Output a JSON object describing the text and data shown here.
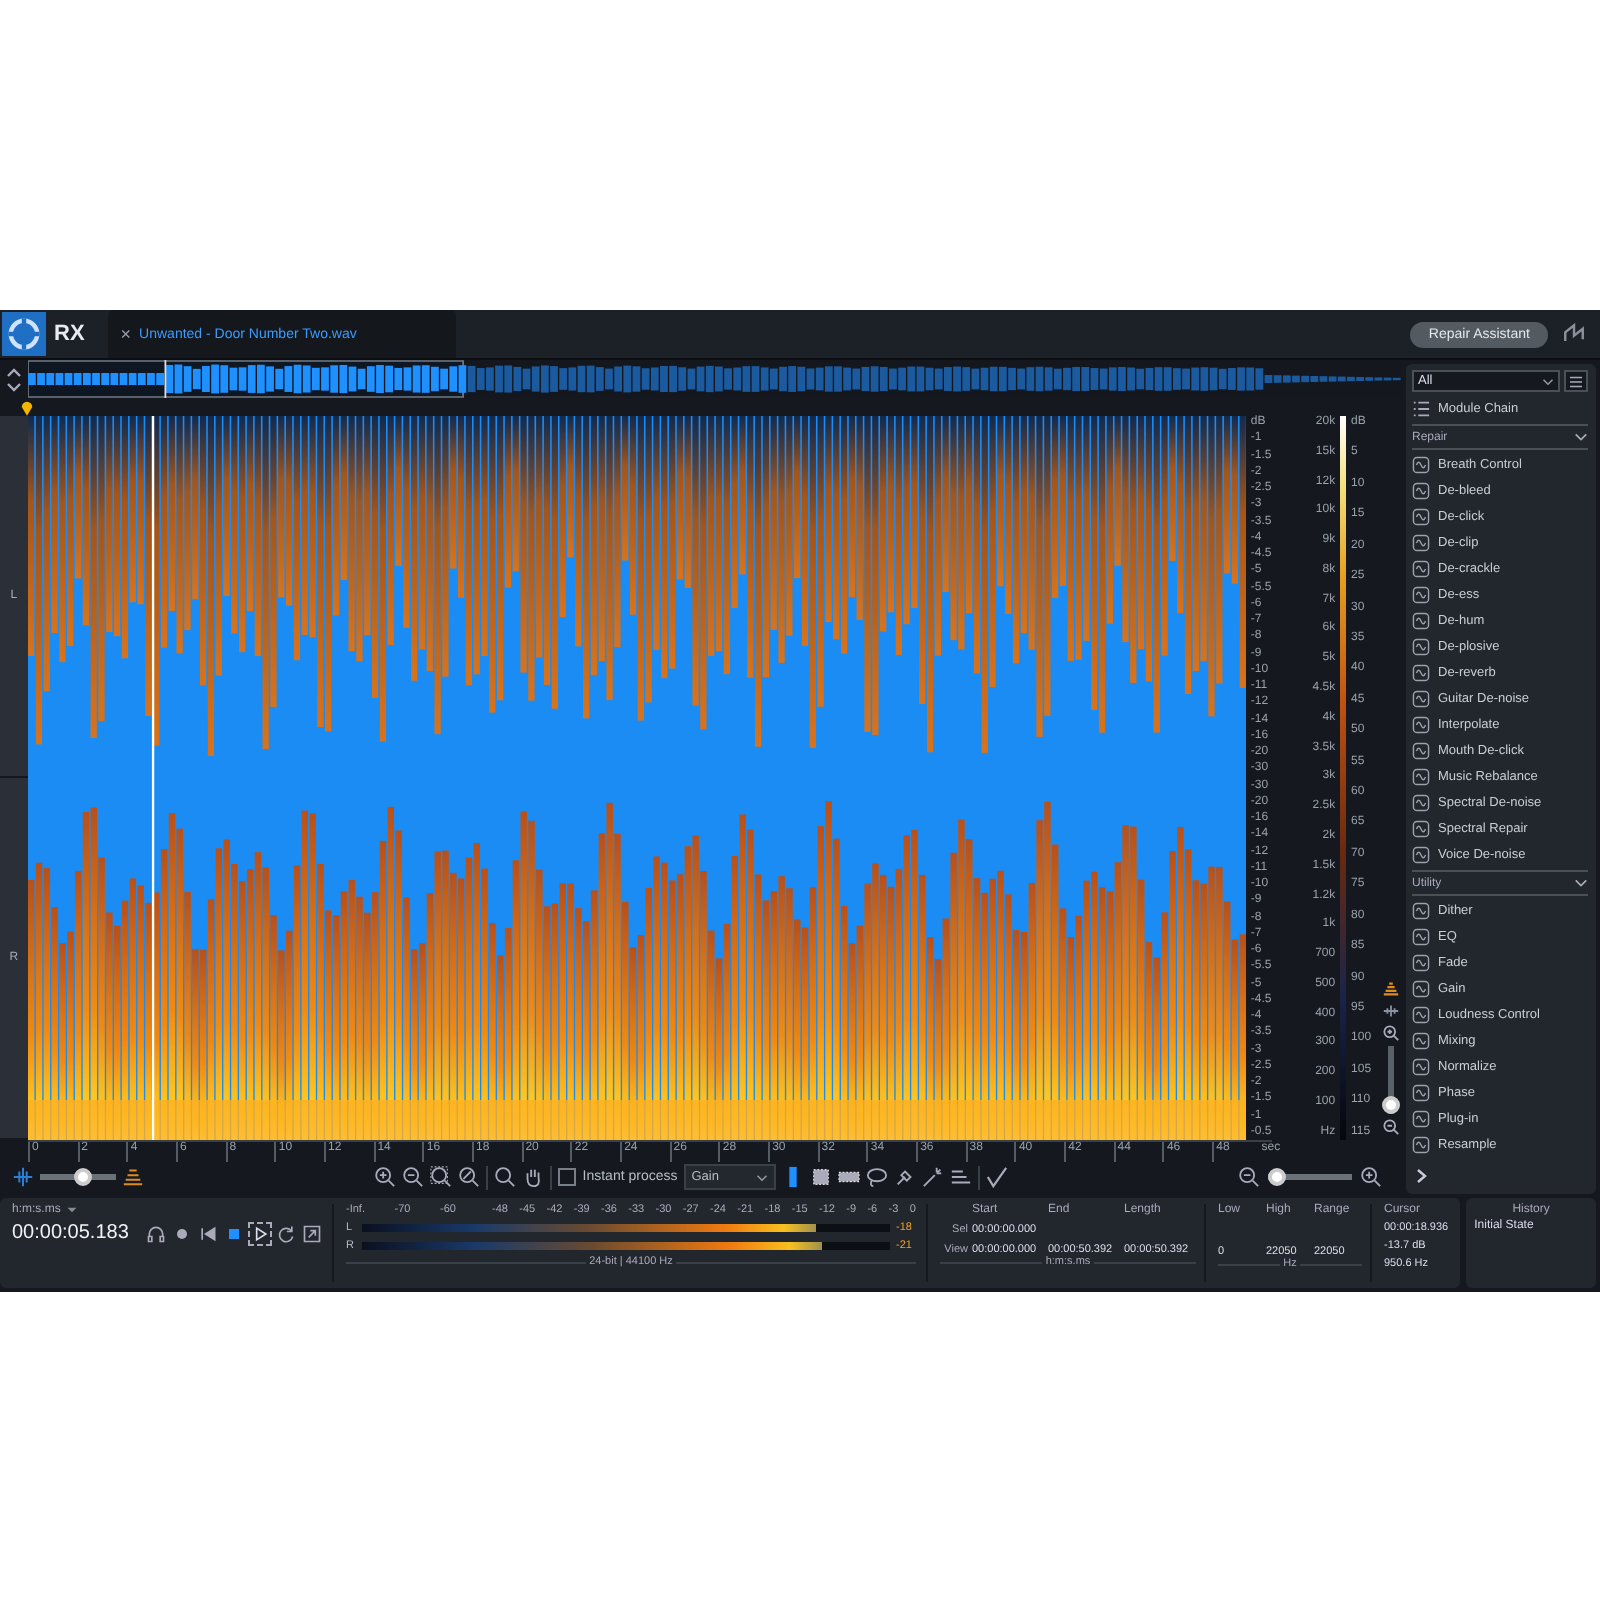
{
  "app": {
    "logo": "RX",
    "tab": {
      "title": "Unwanted - Door Number Two.wav",
      "close": "×"
    },
    "repair_assistant": "Repair Assistant"
  },
  "spectrogram": {
    "channels": [
      "L",
      "R"
    ],
    "amplitude_scale": [
      "dB",
      "-1",
      "-1.5",
      "-2",
      "-2.5",
      "-3",
      "-3.5",
      "-4",
      "-4.5",
      "-5",
      "-5.5",
      "-6",
      "-7",
      "-8",
      "-9",
      "-10",
      "-11",
      "-12",
      "-14",
      "-16",
      "-20",
      "-30",
      "-30",
      "-20",
      "-16",
      "-14",
      "-12",
      "-11",
      "-10",
      "-9",
      "-8",
      "-7",
      "-6",
      "-5.5",
      "-5",
      "-4.5",
      "-4",
      "-3.5",
      "-3",
      "-2.5",
      "-2",
      "-1.5",
      "-1",
      "-0.5"
    ],
    "frequency_scale": [
      "20k",
      "15k",
      "12k",
      "10k",
      "9k",
      "8k",
      "7k",
      "6k",
      "5k",
      "4.5k",
      "4k",
      "3.5k",
      "3k",
      "2.5k",
      "2k",
      "1.5k",
      "1.2k",
      "1k",
      "700",
      "500",
      "400",
      "300",
      "200",
      "100"
    ],
    "frequency_unit": "Hz",
    "color_scale": [
      "dB",
      "5",
      "10",
      "15",
      "20",
      "25",
      "30",
      "35",
      "40",
      "45",
      "50",
      "55",
      "60",
      "65",
      "70",
      "75",
      "80",
      "85",
      "90",
      "95",
      "100",
      "105",
      "110",
      "115"
    ],
    "time_axis": [
      "0",
      "2",
      "4",
      "6",
      "8",
      "10",
      "12",
      "14",
      "16",
      "18",
      "20",
      "22",
      "24",
      "26",
      "28",
      "30",
      "32",
      "34",
      "36",
      "38",
      "40",
      "42",
      "44",
      "46",
      "48"
    ],
    "time_unit": "sec"
  },
  "toolbar": {
    "opacity_slider": {
      "level": 0.6
    },
    "instant_process": {
      "label": "Instant process",
      "checked": false
    },
    "process_dropdown": "Gain",
    "tools": [
      {
        "kind": "time",
        "selected": true
      },
      {
        "kind": "time-frequency",
        "selected": false
      },
      {
        "kind": "frequency",
        "selected": false
      },
      {
        "kind": "lasso",
        "selected": false
      },
      {
        "kind": "brush",
        "selected": false
      },
      {
        "kind": "wand",
        "selected": false
      },
      {
        "kind": "harmonic",
        "selected": false
      }
    ],
    "horizontal_zoom": {
      "level": 0.0
    },
    "vertical_zoom": {
      "level": 0.0
    }
  },
  "transport": {
    "time_format": "h:m:s.ms",
    "time": "00:00:05.183",
    "buttons": [
      {
        "kind": "headphones",
        "selected": false
      },
      {
        "kind": "record",
        "selected": false
      },
      {
        "kind": "previous",
        "selected": false
      },
      {
        "kind": "stop",
        "selected": false
      },
      {
        "kind": "play",
        "selected": true
      },
      {
        "kind": "loop",
        "selected": false
      },
      {
        "kind": "export",
        "selected": false
      }
    ]
  },
  "meter": {
    "scale": [
      "-Inf.",
      "-70",
      "-60",
      "-48",
      "-45",
      "-42",
      "-39",
      "-36",
      "-33",
      "-30",
      "-27",
      "-24",
      "-21",
      "-18",
      "-15",
      "-12",
      "-9",
      "-6",
      "-3",
      "0"
    ],
    "channels": [
      {
        "name": "L",
        "level": 0.86,
        "reading": "-18"
      },
      {
        "name": "R",
        "level": 0.87,
        "reading": "-21"
      }
    ],
    "format": "24-bit | 44100 Hz"
  },
  "selection": {
    "columns": [
      "Start",
      "End",
      "Length"
    ],
    "rows": [
      {
        "label": "Sel",
        "cells": [
          "00:00:00.000"
        ]
      },
      {
        "label": "View",
        "cells": [
          "00:00:00.000",
          "00:00:50.392",
          "00:00:50.392"
        ]
      }
    ],
    "unit": "h:m:s.ms"
  },
  "frequency_range": {
    "columns": [
      "Low",
      "High",
      "Range"
    ],
    "cells": [
      "0",
      "22050",
      "22050"
    ],
    "unit": "Hz"
  },
  "cursor": {
    "label": "Cursor",
    "values": [
      "00:00:18.936",
      "-13.7 dB",
      "950.6 Hz"
    ]
  },
  "history": {
    "title": "History",
    "items": [
      "Initial State"
    ]
  },
  "modules": {
    "filter": "All",
    "chain": "Module Chain",
    "sections": [
      {
        "name": "Repair",
        "expanded": true,
        "items": [
          "Breath Control",
          "De-bleed",
          "De-click",
          "De-clip",
          "De-crackle",
          "De-ess",
          "De-hum",
          "De-plosive",
          "De-reverb",
          "Guitar De-noise",
          "Interpolate",
          "Mouth De-click",
          "Music Rebalance",
          "Spectral De-noise",
          "Spectral Repair",
          "Voice De-noise"
        ]
      },
      {
        "name": "Utility",
        "expanded": true,
        "items": [
          "Dither",
          "EQ",
          "Fade",
          "Gain",
          "Loudness Control",
          "Mixing",
          "Normalize",
          "Phase",
          "Plug-in",
          "Resample"
        ]
      }
    ]
  }
}
